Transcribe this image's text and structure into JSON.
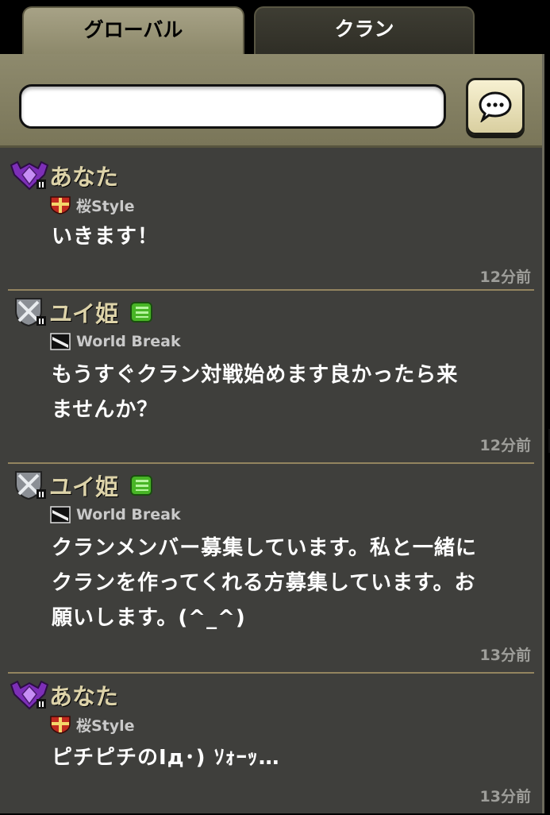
{
  "tabs": [
    {
      "label": "グローバル",
      "active": true
    },
    {
      "label": "クラン",
      "active": false
    }
  ],
  "chat_input": {
    "value": "",
    "placeholder": ""
  },
  "send_button": {
    "icon": "speech-bubble-icon"
  },
  "messages": [
    {
      "user": "あなた",
      "league_icon": "purple-shield-icon",
      "clan": "桜Style",
      "clan_icon": "red-cross-shield-icon",
      "text": "いきます！",
      "time": "12分前"
    },
    {
      "user": "ユイ姫",
      "league_icon": "silver-shield-icon",
      "badge": "green-level-badge",
      "clan": "World Break",
      "clan_icon": "black-white-emblem-icon",
      "text_lines": [
        "もうすぐクラン対戦始めます良かったら来",
        "ませんか？"
      ],
      "time": "12分前"
    },
    {
      "user": "ユイ姫",
      "league_icon": "silver-shield-icon",
      "badge": "green-level-badge",
      "clan": "World Break",
      "clan_icon": "black-white-emblem-icon",
      "text_lines": [
        "クランメンバー募集しています。私と一緒に",
        "クランを作ってくれる方募集しています。お",
        "願いします。(^_^)"
      ],
      "time": "13分前"
    },
    {
      "user": "あなた",
      "league_icon": "purple-shield-icon",
      "clan": "桜Style",
      "clan_icon": "red-cross-shield-icon",
      "text": "ピチピチのIд･) ｿｫｰｯ…",
      "time": "13分前"
    }
  ],
  "colors": {
    "panel_bg": "#3f3f3c",
    "header_bg": "#8e8a6d",
    "name": "#ddd3a9",
    "divider": "#93845f",
    "time": "#9e9e9a"
  }
}
